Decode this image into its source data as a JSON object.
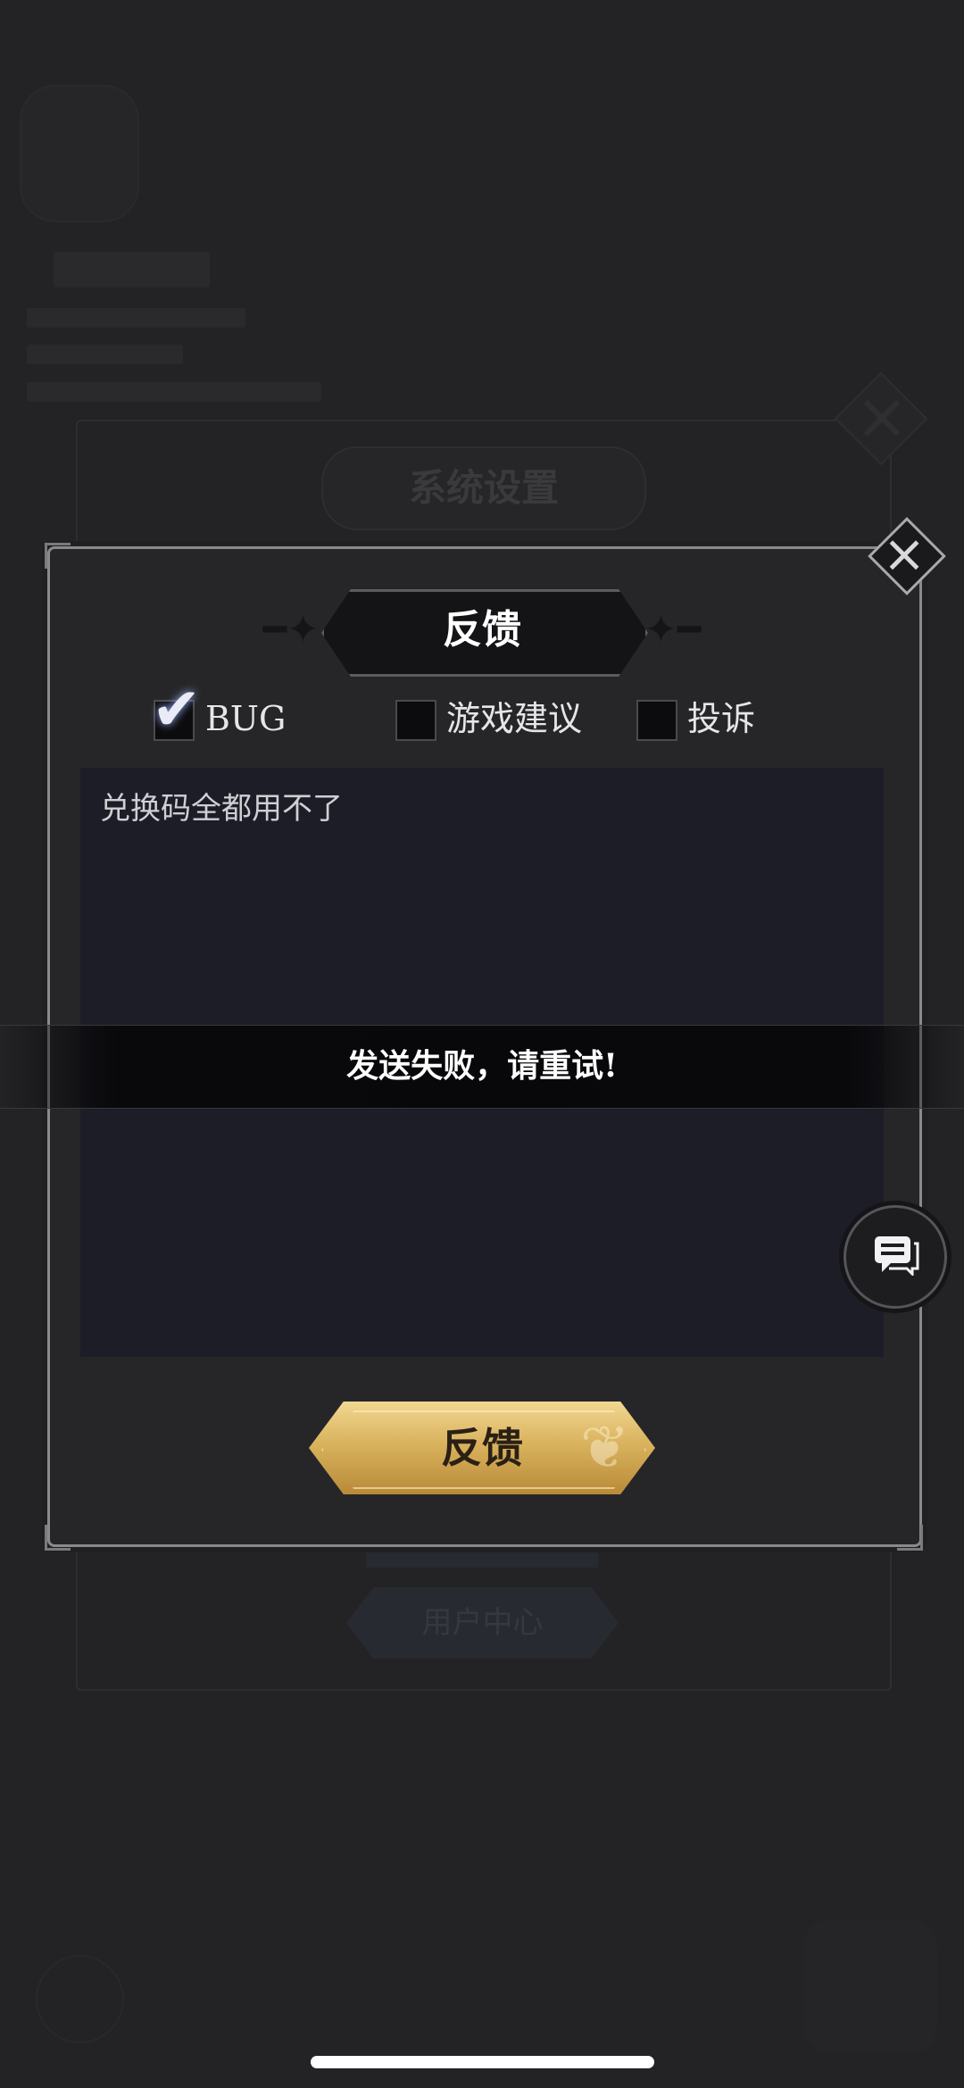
{
  "background": {
    "settings_title": "系统设置",
    "user_center_button": "用户中心"
  },
  "dialog": {
    "title": "反馈",
    "categories": [
      {
        "label": "BUG",
        "checked": true
      },
      {
        "label": "游戏建议",
        "checked": false
      },
      {
        "label": "投诉",
        "checked": false
      }
    ],
    "feedback_text": "兑换码全都用不了",
    "submit_label": "反馈"
  },
  "toast": {
    "message": "发送失败，请重试!"
  },
  "icons": {
    "close": "close-icon",
    "check": "checkmark-icon",
    "chat": "chat-bubble-icon"
  },
  "colors": {
    "gold_button": "#d9b35e",
    "textarea_bg": "#1c1d26",
    "page_bg": "#232325"
  }
}
